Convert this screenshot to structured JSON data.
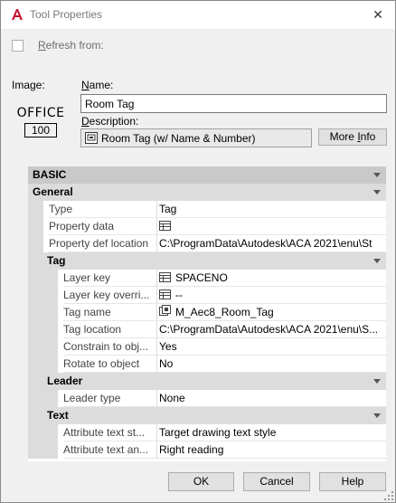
{
  "window": {
    "title": "Tool Properties",
    "close_glyph": "✕",
    "app_icon": "autocad-a-icon",
    "accent_color": "#c8102e"
  },
  "refresh": {
    "label_key": "R",
    "label_rest": "efresh from:",
    "checked": false
  },
  "image_panel": {
    "label": "Image:",
    "preview_word": "OFFICE",
    "preview_number": "100"
  },
  "name": {
    "label_key": "N",
    "label_rest": "ame:",
    "value": "Room Tag"
  },
  "description": {
    "label_key": "D",
    "label_rest": "escription:",
    "value": "Room Tag (w/ Name & Number)",
    "icon": "tool-icon"
  },
  "more_info_button": {
    "label_pre": "More ",
    "label_key": "I",
    "label_post": "nfo"
  },
  "property_grid": {
    "sections": [
      {
        "title": "BASIC",
        "groups": [
          {
            "title": "General",
            "rows": [
              {
                "name": "Type",
                "value": "Tag",
                "icon": ""
              },
              {
                "name": "Property data",
                "value": "",
                "icon": "table-icon"
              },
              {
                "name": "Property def location",
                "value": "C:\\ProgramData\\Autodesk\\ACA  2021\\enu\\St",
                "icon": ""
              }
            ]
          },
          {
            "title": "Tag",
            "rows": [
              {
                "name": "Layer key",
                "value": "SPACENO",
                "icon": "table-icon"
              },
              {
                "name": "Layer key overri...",
                "value": "--",
                "icon": "table-icon"
              },
              {
                "name": "Tag name",
                "value": "M_Aec8_Room_Tag",
                "icon": "block-icon"
              },
              {
                "name": "Tag location",
                "value": "C:\\ProgramData\\Autodesk\\ACA  2021\\enu\\S...",
                "icon": ""
              },
              {
                "name": "Constrain to obj...",
                "value": "Yes",
                "icon": ""
              },
              {
                "name": "Rotate to object",
                "value": "No",
                "icon": ""
              }
            ]
          },
          {
            "title": "Leader",
            "rows": [
              {
                "name": "Leader type",
                "value": "None",
                "icon": ""
              }
            ]
          },
          {
            "title": "Text",
            "rows": [
              {
                "name": "Attribute text st...",
                "value": "Target drawing text style",
                "icon": ""
              },
              {
                "name": "Attribute text an...",
                "value": "Right reading",
                "icon": ""
              }
            ]
          }
        ]
      }
    ]
  },
  "buttons": {
    "ok": "OK",
    "cancel": "Cancel",
    "help": "Help"
  }
}
